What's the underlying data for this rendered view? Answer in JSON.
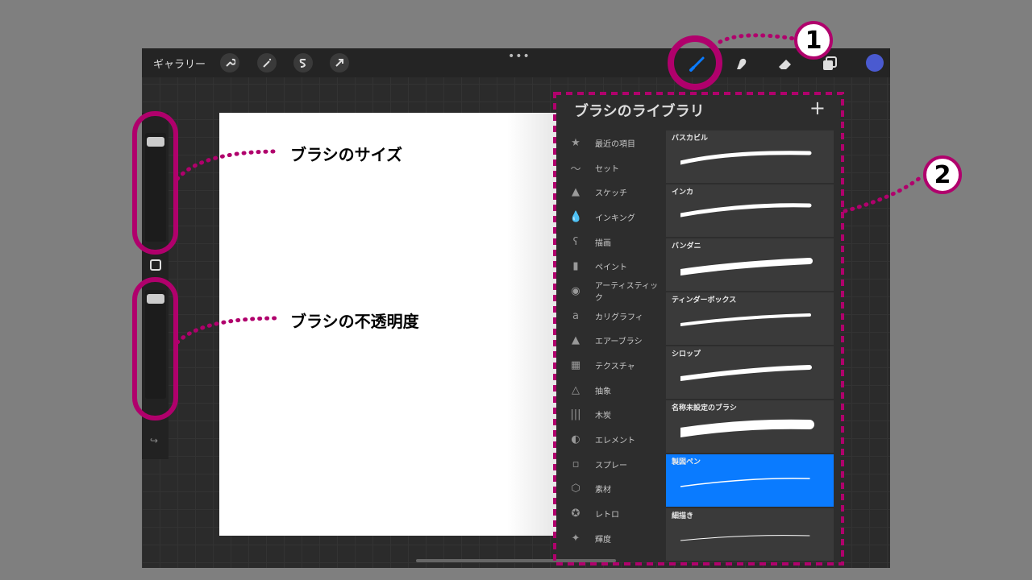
{
  "toolbar": {
    "gallery": "ギャラリー",
    "more": "•••"
  },
  "colors": {
    "accent": "#0a7bff",
    "annotation": "#b0006c",
    "current_color": "#4a5ad0"
  },
  "library": {
    "title": "ブラシのライブラリ",
    "add": "+",
    "categories": [
      {
        "label": "最近の項目",
        "icon": "★"
      },
      {
        "label": "セット",
        "icon": "〜"
      },
      {
        "label": "スケッチ",
        "icon": "▲"
      },
      {
        "label": "インキング",
        "icon": "💧"
      },
      {
        "label": "描画",
        "icon": "ʕ"
      },
      {
        "label": "ペイント",
        "icon": "▮"
      },
      {
        "label": "アーティスティック",
        "icon": "◉"
      },
      {
        "label": "カリグラフィ",
        "icon": "a"
      },
      {
        "label": "エアーブラシ",
        "icon": "▲"
      },
      {
        "label": "テクスチャ",
        "icon": "▦"
      },
      {
        "label": "抽象",
        "icon": "△"
      },
      {
        "label": "木炭",
        "icon": "|||"
      },
      {
        "label": "エレメント",
        "icon": "◐"
      },
      {
        "label": "スプレー",
        "icon": "▫"
      },
      {
        "label": "素材",
        "icon": "⬡"
      },
      {
        "label": "レトロ",
        "icon": "✪"
      },
      {
        "label": "輝度",
        "icon": "✦"
      }
    ],
    "brushes": [
      {
        "name": "バスカビル"
      },
      {
        "name": "インカ"
      },
      {
        "name": "バンダニ"
      },
      {
        "name": "ティンダーボックス"
      },
      {
        "name": "シロップ"
      },
      {
        "name": "名称未設定のブラシ"
      },
      {
        "name": "製図ペン"
      },
      {
        "name": "細描き"
      }
    ]
  },
  "annotations": {
    "brush_size": "ブラシのサイズ",
    "brush_opacity": "ブラシの不透明度",
    "badge1": "1",
    "badge2": "2"
  }
}
